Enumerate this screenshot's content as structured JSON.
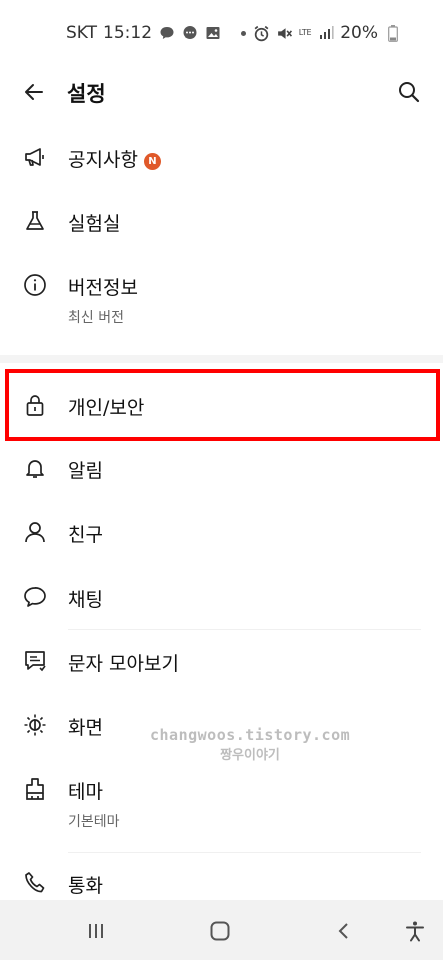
{
  "status_bar": {
    "carrier": "SKT",
    "time": "15:12",
    "network": "LTE",
    "battery": "20%"
  },
  "header": {
    "title": "설정"
  },
  "menu": {
    "notice": {
      "label": "공지사항",
      "badge": "N"
    },
    "lab": {
      "label": "실험실"
    },
    "version": {
      "label": "버전정보",
      "sub": "최신 버전"
    },
    "privacy": {
      "label": "개인/보안"
    },
    "notifications": {
      "label": "알림"
    },
    "friends": {
      "label": "친구"
    },
    "chatting": {
      "label": "채팅"
    },
    "sms": {
      "label": "문자 모아보기"
    },
    "display": {
      "label": "화면"
    },
    "theme": {
      "label": "테마",
      "sub": "기본테마"
    },
    "call": {
      "label": "통화"
    }
  },
  "watermark": {
    "line1": "changwoos.tistory.com",
    "line2": "짱우이야기"
  },
  "colors": {
    "highlight_border": "#ff0000",
    "badge": "#e0592a"
  }
}
